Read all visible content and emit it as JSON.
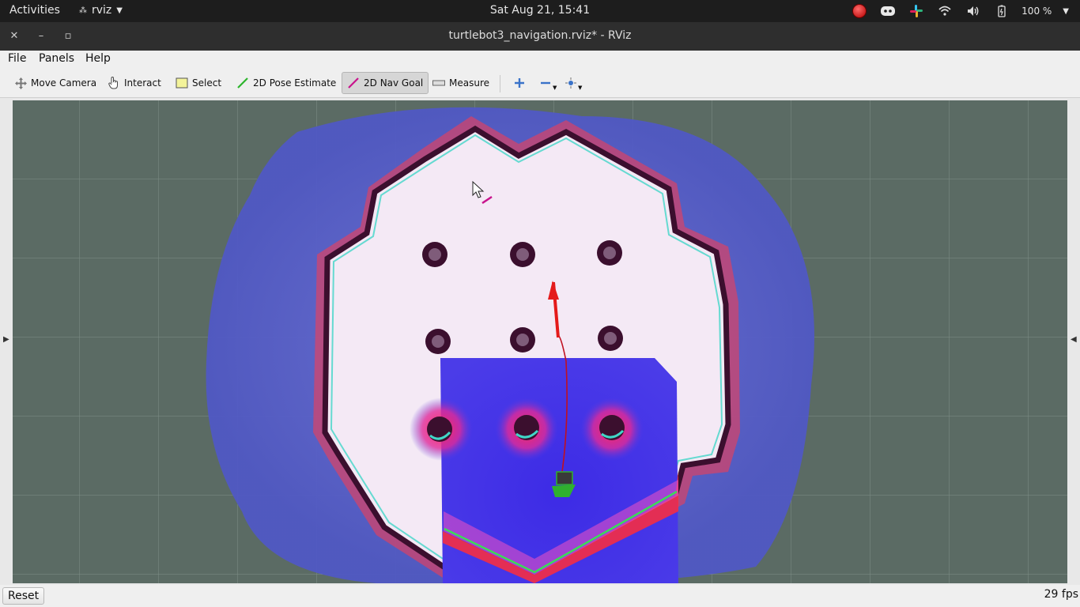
{
  "topbar": {
    "activities": "Activities",
    "app_name": "rviz",
    "clock": "Sat Aug 21, 15:41",
    "battery": "100 %"
  },
  "window": {
    "title": "turtlebot3_navigation.rviz* - RViz"
  },
  "menu": {
    "file": "File",
    "panels": "Panels",
    "help": "Help"
  },
  "toolbar": {
    "move_camera": "Move Camera",
    "interact": "Interact",
    "select": "Select",
    "pose_estimate": "2D Pose Estimate",
    "nav_goal": "2D Nav Goal",
    "measure": "Measure"
  },
  "status": {
    "reset": "Reset",
    "fps": "29 fps"
  },
  "colors": {
    "grid_bg": "#5b6b64",
    "free_space": "#f6ecf6",
    "wall": "#3b0f2e",
    "inflation_outer": "#5a63c8",
    "costmap_local": "#4a34e0",
    "pose_arrow": "#e41a1a",
    "robot": "#2fb02f",
    "nav_goal_accent": "#c8138c"
  }
}
